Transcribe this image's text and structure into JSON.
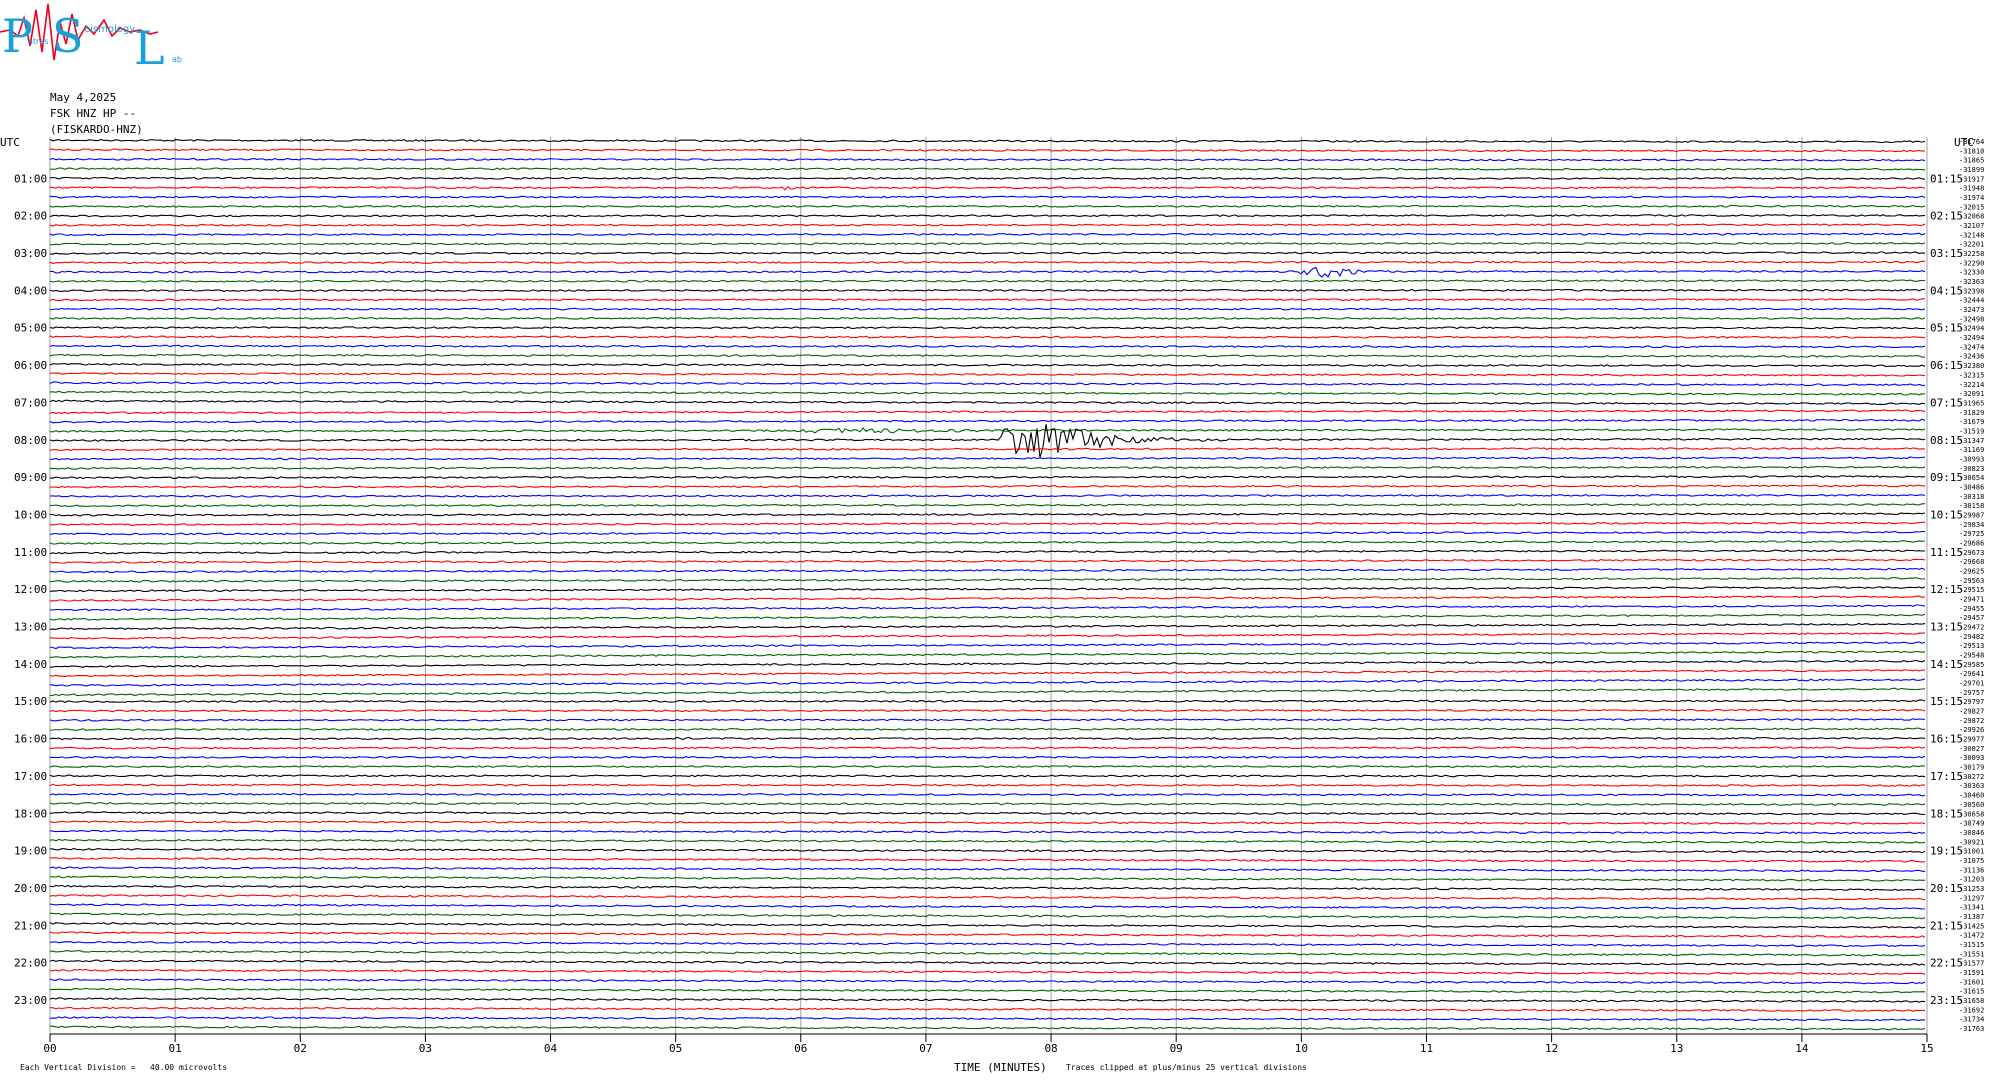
{
  "logo": {
    "letters": [
      "P",
      "S",
      "L"
    ],
    "small_words": [
      "atras",
      "eismology",
      "ab"
    ],
    "colors": {
      "letters": "#1aa0d8",
      "trace": "#e8001c"
    }
  },
  "header": {
    "date": "May 4,2025",
    "channel": "FSK HNZ HP --",
    "station": "(FISKARDO-HNZ)"
  },
  "axis": {
    "left_title": "UTC",
    "right_title": "UTC",
    "x_title": "TIME (MINUTES)",
    "scale_note": "Each Vertical Division =   40.00 microvolts",
    "clip_note": "Traces clipped at plus/minus 25 vertical divisions"
  },
  "chart_data": {
    "type": "line",
    "title": "",
    "xlabel": "TIME (MINUTES)",
    "ylabel": "UTC",
    "xlim": [
      0,
      15
    ],
    "x_ticks": [
      "00",
      "01",
      "02",
      "03",
      "04",
      "05",
      "06",
      "07",
      "08",
      "09",
      "10",
      "11",
      "12",
      "13",
      "14",
      "15"
    ],
    "left_hour_labels": [
      "01:00",
      "02:00",
      "03:00",
      "04:00",
      "05:00",
      "06:00",
      "07:00",
      "08:00",
      "09:00",
      "10:00",
      "11:00",
      "12:00",
      "13:00",
      "14:00",
      "15:00",
      "16:00",
      "17:00",
      "18:00",
      "19:00",
      "20:00",
      "21:00",
      "22:00",
      "23:00"
    ],
    "right_hour_labels": [
      "01:15",
      "02:15",
      "03:15",
      "04:15",
      "05:15",
      "06:15",
      "07:15",
      "08:15",
      "09:15",
      "10:15",
      "11:15",
      "12:15",
      "13:15",
      "14:15",
      "15:15",
      "16:15",
      "17:15",
      "18:15",
      "19:15",
      "20:15",
      "21:15",
      "22:15",
      "23:15"
    ],
    "trace_colors": [
      "#000000",
      "#ff0000",
      "#0000ff",
      "#006400"
    ],
    "trace_count": 96,
    "trace_values": [
      "-31764",
      "-31810",
      "-31865",
      "-31899",
      "-31917",
      "-31948",
      "-31974",
      "-32015",
      "-32068",
      "-32107",
      "-32148",
      "-32201",
      "-32258",
      "-32290",
      "-32330",
      "-32363",
      "-32398",
      "-32444",
      "-32473",
      "-32498",
      "-32494",
      "-32494",
      "-32474",
      "-32436",
      "-32380",
      "-32315",
      "-32214",
      "-32091",
      "-31965",
      "-31829",
      "-31679",
      "-31519",
      "-31347",
      "-31169",
      "-30993",
      "-30823",
      "-30654",
      "-30486",
      "-30318",
      "-30158",
      "-29987",
      "-29834",
      "-29725",
      "-29686",
      "-29673",
      "-29668",
      "-29625",
      "-29563",
      "-29515",
      "-29471",
      "-29455",
      "-29457",
      "-29472",
      "-29482",
      "-29513",
      "-29548",
      "-29585",
      "-29641",
      "-29701",
      "-29757",
      "-29797",
      "-29827",
      "-29872",
      "-29926",
      "-29977",
      "-30027",
      "-30093",
      "-30179",
      "-30272",
      "-30363",
      "-30460",
      "-30560",
      "-30658",
      "-30749",
      "-30846",
      "-30921",
      "-31001",
      "-31075",
      "-31136",
      "-31203",
      "-31253",
      "-31297",
      "-31341",
      "-31387",
      "-31425",
      "-31472",
      "-31515",
      "-31551",
      "-31577",
      "-31591",
      "-31601",
      "-31615",
      "-31658",
      "-31692",
      "-31734",
      "-31763"
    ],
    "events": [
      {
        "trace": 5,
        "minute": 5.9,
        "amplitude": "small"
      },
      {
        "trace": 14,
        "minute": 10.15,
        "amplitude": "medium"
      },
      {
        "trace": 18,
        "minute": 1.3,
        "amplitude": "tiny"
      },
      {
        "trace": 32,
        "minute": 7.9,
        "amplitude": "large"
      },
      {
        "trace": 31,
        "minute": 6.5,
        "amplitude": "noise"
      },
      {
        "trace": 64,
        "minute": 5.0,
        "amplitude": "small"
      },
      {
        "trace": 81,
        "minute": 1.9,
        "amplitude": "tiny"
      }
    ]
  }
}
